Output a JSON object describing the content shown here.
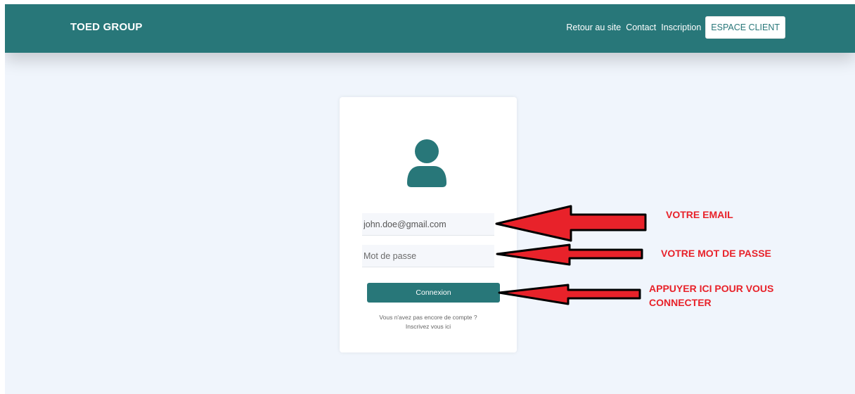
{
  "navbar": {
    "brand": "TOED GROUP",
    "links": [
      "Retour au site",
      "Contact",
      "Inscription"
    ],
    "client_button": "ESPACE CLIENT"
  },
  "login": {
    "avatar_icon": "user-icon",
    "email_value": "john.doe@gmail.com",
    "password_placeholder": "Mot de passe",
    "submit_label": "Connexion",
    "hint_text": "Vous n'avez pas encore de compte ?",
    "hint_link": "Inscrivez vous ici"
  },
  "annotations": {
    "email": "VOTRE EMAIL",
    "password": "VOTRE MOT DE PASSE",
    "connect_line1": "APPUYER ICI POUR VOUS",
    "connect_line2": "CONNECTER"
  },
  "colors": {
    "primary": "#287779",
    "background": "#f0f5fc",
    "annotation": "#e8222a"
  }
}
